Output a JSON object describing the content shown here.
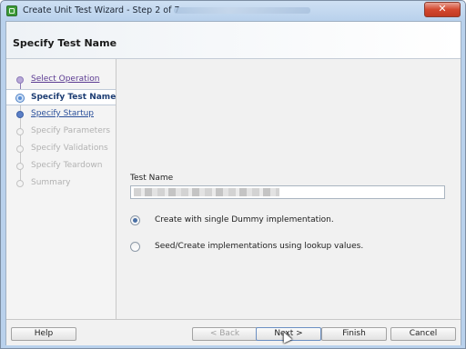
{
  "window": {
    "title": "Create Unit Test Wizard - Step 2 of 7",
    "close_label": "✕"
  },
  "header": {
    "title": "Specify Test Name"
  },
  "nav": {
    "items": [
      {
        "label": "Select Operation",
        "state": "visited"
      },
      {
        "label": "Specify Test Name",
        "state": "current"
      },
      {
        "label": "Specify Startup",
        "state": "enabled"
      },
      {
        "label": "Specify Parameters",
        "state": "disabled"
      },
      {
        "label": "Specify Validations",
        "state": "disabled"
      },
      {
        "label": "Specify Teardown",
        "state": "disabled"
      },
      {
        "label": "Summary",
        "state": "disabled"
      }
    ]
  },
  "form": {
    "test_name_label": "Test Name",
    "test_name_value": "",
    "options": [
      {
        "label": "Create with single Dummy implementation.",
        "checked": true
      },
      {
        "label": "Seed/Create implementations using lookup values.",
        "checked": false
      }
    ]
  },
  "footer": {
    "help": "Help",
    "back": "< Back",
    "next": "Next >",
    "finish": "Finish",
    "cancel": "Cancel"
  },
  "colors": {
    "titlebar": "#b9d1ec",
    "nav_current": "#1d3d73",
    "nav_visited": "#5b3a91",
    "close_button": "#d3482f"
  }
}
